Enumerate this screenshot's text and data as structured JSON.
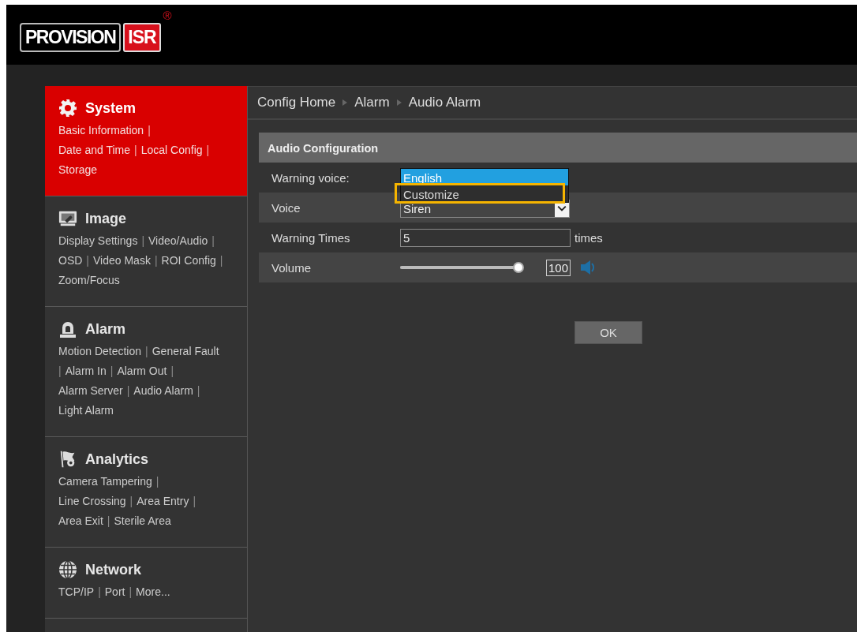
{
  "logo": {
    "wordmark": "PROVISION",
    "badge": "ISR",
    "mark": "®"
  },
  "sidebar": {
    "sections": [
      {
        "title": "System",
        "kind": "gear",
        "selected": true,
        "lines": [
          [
            {
              "kind": "link",
              "text": "Basic Information"
            },
            {
              "kind": "sep",
              "text": "|"
            }
          ],
          [
            {
              "kind": "link",
              "text": "Date and Time"
            },
            {
              "kind": "sep",
              "text": "|"
            },
            {
              "kind": "link",
              "text": "Local Config"
            },
            {
              "kind": "sep",
              "text": "|"
            }
          ],
          [
            {
              "kind": "link",
              "text": "Storage"
            }
          ]
        ]
      },
      {
        "title": "Image",
        "kind": "monitor",
        "selected": false,
        "lines": [
          [
            {
              "kind": "link",
              "text": "Display Settings"
            },
            {
              "kind": "sep",
              "text": "|"
            },
            {
              "kind": "link",
              "text": "Video/Audio"
            },
            {
              "kind": "sep",
              "text": "|"
            }
          ],
          [
            {
              "kind": "link",
              "text": "OSD"
            },
            {
              "kind": "sep",
              "text": "|"
            },
            {
              "kind": "link",
              "text": "Video Mask"
            },
            {
              "kind": "sep",
              "text": "|"
            },
            {
              "kind": "link",
              "text": "ROI Config"
            },
            {
              "kind": "sep",
              "text": "|"
            }
          ],
          [
            {
              "kind": "link",
              "text": "Zoom/Focus"
            }
          ]
        ]
      },
      {
        "title": "Alarm",
        "kind": "siren",
        "selected": false,
        "lines": [
          [
            {
              "kind": "link",
              "text": "Motion Detection"
            },
            {
              "kind": "sep",
              "text": "|"
            },
            {
              "kind": "link",
              "text": "General Fault"
            }
          ],
          [
            {
              "kind": "sep",
              "text": "|"
            },
            {
              "kind": "link",
              "text": "Alarm In"
            },
            {
              "kind": "sep",
              "text": "|"
            },
            {
              "kind": "link",
              "text": "Alarm Out"
            },
            {
              "kind": "sep",
              "text": "|"
            }
          ],
          [
            {
              "kind": "link",
              "text": "Alarm Server"
            },
            {
              "kind": "sep",
              "text": "|"
            },
            {
              "kind": "link",
              "text": "Audio Alarm"
            },
            {
              "kind": "sep",
              "text": "|"
            }
          ],
          [
            {
              "kind": "link",
              "text": "Light Alarm"
            }
          ]
        ]
      },
      {
        "title": "Analytics",
        "kind": "flag",
        "selected": false,
        "lines": [
          [
            {
              "kind": "link",
              "text": "Camera Tampering"
            },
            {
              "kind": "sep",
              "text": "|"
            }
          ],
          [
            {
              "kind": "link",
              "text": "Line Crossing"
            },
            {
              "kind": "sep",
              "text": "|"
            },
            {
              "kind": "link",
              "text": "Area Entry"
            },
            {
              "kind": "sep",
              "text": "|"
            }
          ],
          [
            {
              "kind": "link",
              "text": "Area Exit"
            },
            {
              "kind": "sep",
              "text": "|"
            },
            {
              "kind": "link",
              "text": "Sterile Area"
            }
          ]
        ]
      },
      {
        "title": "Network",
        "kind": "globe",
        "selected": false,
        "lines": [
          [
            {
              "kind": "link",
              "text": "TCP/IP"
            },
            {
              "kind": "sep",
              "text": "|"
            },
            {
              "kind": "link",
              "text": "Port"
            },
            {
              "kind": "sep",
              "text": "|"
            },
            {
              "kind": "link",
              "text": "More..."
            }
          ]
        ]
      }
    ]
  },
  "breadcrumb": [
    "Config Home",
    "Alarm",
    "Audio Alarm"
  ],
  "panel": {
    "title": "Audio Configuration",
    "rows": [
      {
        "kind": "dropdown",
        "label": "Warning voice:",
        "options": [
          {
            "label": "English",
            "selected": true,
            "highlighted": false
          },
          {
            "label": "Customize",
            "selected": false,
            "highlighted": true
          }
        ]
      },
      {
        "kind": "select",
        "label": "Voice",
        "value": "Siren"
      },
      {
        "kind": "number",
        "label": "Warning Times",
        "value": "5",
        "unit": "times"
      },
      {
        "kind": "slider",
        "label": "Volume",
        "level": 1.0,
        "value": "100"
      }
    ]
  },
  "ok_button": "OK"
}
